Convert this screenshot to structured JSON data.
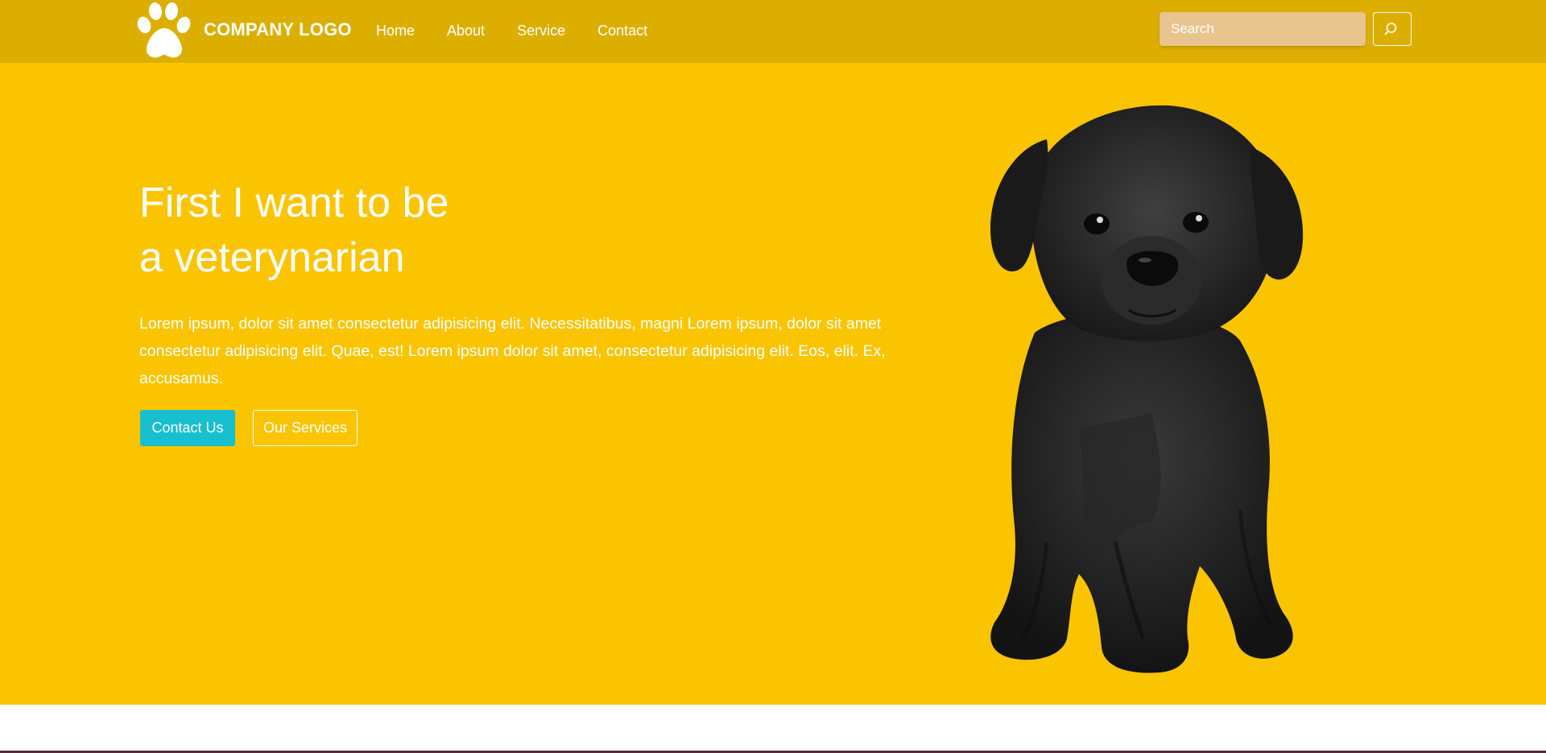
{
  "navbar": {
    "brand": "COMPANY LOGO",
    "links": [
      "Home",
      "About",
      "Service",
      "Contact"
    ],
    "search_placeholder": "Search",
    "search_icon": "search-icon",
    "logo_icon": "paw-icon",
    "background": "#dbae00"
  },
  "hero": {
    "title_line1": "First I want to be",
    "title_line2": "a veterynarian",
    "text": "Lorem ipsum, dolor sit amet consectetur adipisicing elit. Necessitatibus, magni Lorem ipsum, dolor sit amet consectetur adipisicing elit. Quae, est! Lorem ipsum dolor sit amet, consectetur adipisicing elit. Eos, elit. Ex, accusamus.",
    "primary_button": "Contact Us",
    "secondary_button": "Our Services",
    "image": "black-puppy-image",
    "background": "#fbc400",
    "accent": "#17bfcf"
  }
}
